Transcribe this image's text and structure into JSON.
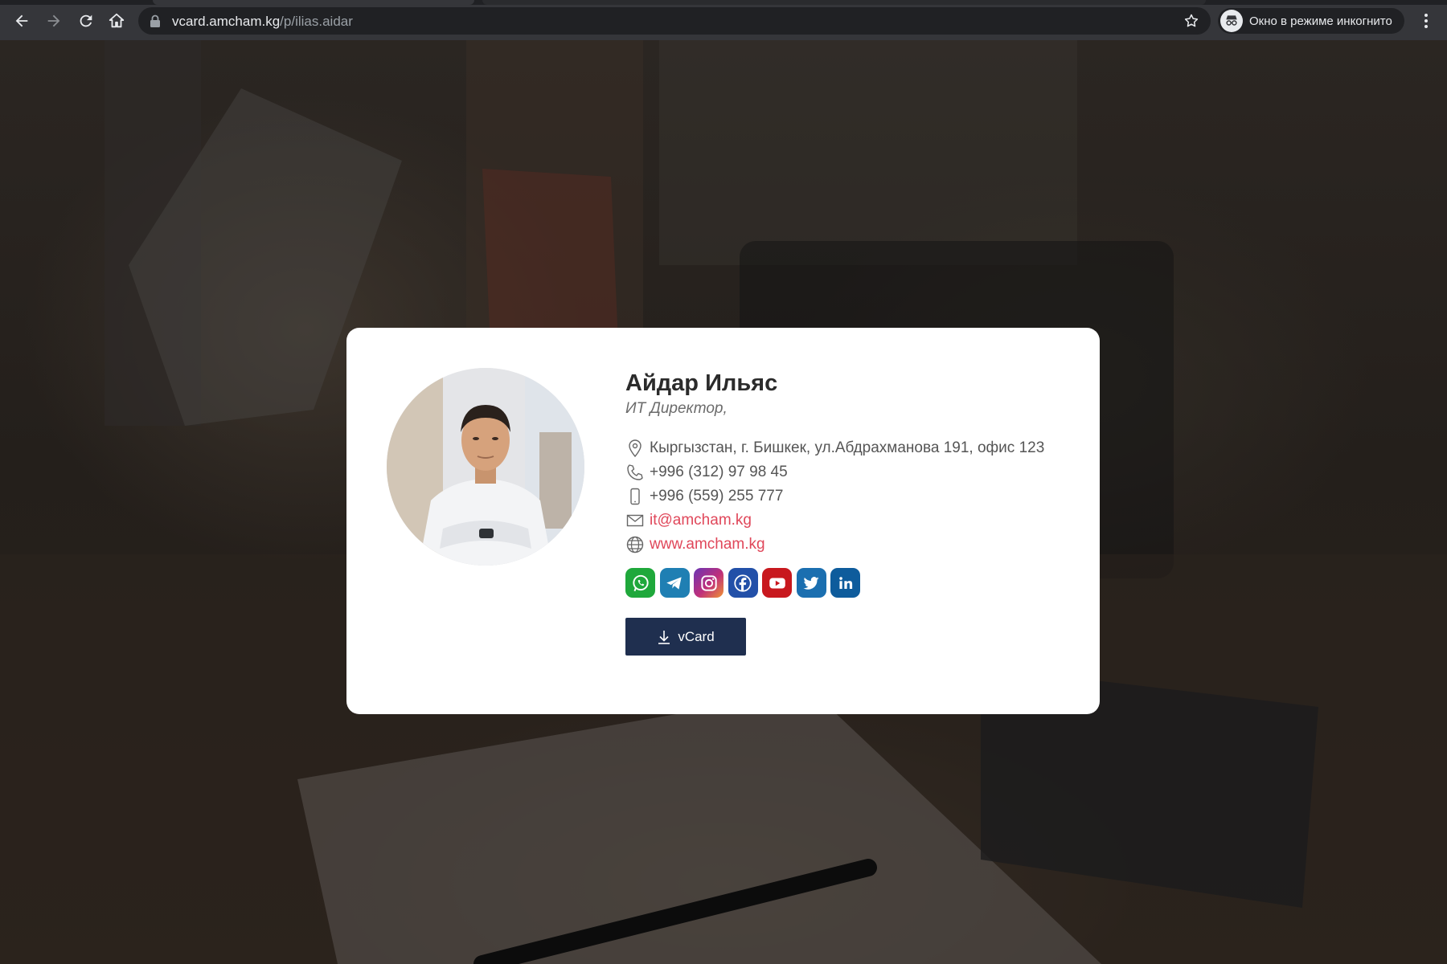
{
  "browser": {
    "url_host": "vcard.amcham.kg",
    "url_path": "/p/ilias.aidar",
    "incognito_label": "Окно в режиме инкогнито"
  },
  "card": {
    "name": "Айдар Ильяс",
    "title": "ИТ Директор,",
    "contacts": [
      {
        "icon": "location-icon",
        "text": "Кыргызстан, г. Бишкек, ул.Абдрахманова 191, офис 123"
      },
      {
        "icon": "phone-icon",
        "text": "+996 (312) 97 98 45"
      },
      {
        "icon": "mobile-icon",
        "text": "+996 (559) 255 777"
      },
      {
        "icon": "email-icon",
        "text": "it@amcham.kg"
      },
      {
        "icon": "globe-icon",
        "text": "www.amcham.kg"
      }
    ],
    "socials": [
      {
        "name": "whatsapp",
        "color": "#1fa83b"
      },
      {
        "name": "telegram",
        "color": "#1f7fb3"
      },
      {
        "name": "instagram",
        "color": "#c0307a"
      },
      {
        "name": "facebook",
        "color": "#2250a8"
      },
      {
        "name": "youtube",
        "color": "#c8181e"
      },
      {
        "name": "twitter",
        "color": "#1b6fb0"
      },
      {
        "name": "linkedin",
        "color": "#0e5c9c"
      }
    ],
    "vcard_button_label": "vCard"
  },
  "colors": {
    "link": "#e0475a",
    "button": "#1f2f4f",
    "chrome": "#35363a"
  }
}
